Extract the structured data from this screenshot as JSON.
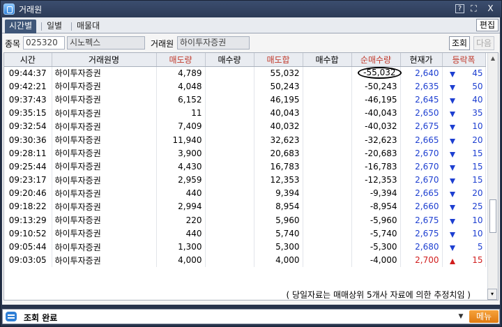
{
  "window": {
    "title": "거래원"
  },
  "titlebar_buttons": {
    "help": "?",
    "restore": "⛶",
    "close": "X"
  },
  "tabs": [
    {
      "label": "시간별",
      "active": true
    },
    {
      "label": "일별",
      "active": false
    },
    {
      "label": "매물대",
      "active": false
    }
  ],
  "edit_label": "편집",
  "filter": {
    "stock_label": "종목",
    "stock_code": "025320",
    "stock_name": "시노펙스",
    "broker_label": "거래원",
    "broker_name": "하이투자증권",
    "query_label": "조회",
    "next_label": "다음"
  },
  "columns": [
    "시간",
    "거래원명",
    "매도량",
    "매수량",
    "매도합",
    "매수합",
    "순매수량",
    "현재가",
    "등락폭"
  ],
  "rows": [
    {
      "time": "09:44:37",
      "broker": "하이투자증권",
      "sell": "4,789",
      "buy": "",
      "sell_sum": "55,032",
      "buy_sum": "",
      "net": "-55,032",
      "price": "2,640",
      "dir": "down",
      "chg": "45"
    },
    {
      "time": "09:42:21",
      "broker": "하이투자증권",
      "sell": "4,048",
      "buy": "",
      "sell_sum": "50,243",
      "buy_sum": "",
      "net": "-50,243",
      "price": "2,635",
      "dir": "down",
      "chg": "50"
    },
    {
      "time": "09:37:43",
      "broker": "하이투자증권",
      "sell": "6,152",
      "buy": "",
      "sell_sum": "46,195",
      "buy_sum": "",
      "net": "-46,195",
      "price": "2,645",
      "dir": "down",
      "chg": "40"
    },
    {
      "time": "09:35:15",
      "broker": "하이투자증권",
      "sell": "11",
      "buy": "",
      "sell_sum": "40,043",
      "buy_sum": "",
      "net": "-40,043",
      "price": "2,650",
      "dir": "down",
      "chg": "35"
    },
    {
      "time": "09:32:54",
      "broker": "하이투자증권",
      "sell": "7,409",
      "buy": "",
      "sell_sum": "40,032",
      "buy_sum": "",
      "net": "-40,032",
      "price": "2,675",
      "dir": "down",
      "chg": "10"
    },
    {
      "time": "09:30:36",
      "broker": "하이투자증권",
      "sell": "11,940",
      "buy": "",
      "sell_sum": "32,623",
      "buy_sum": "",
      "net": "-32,623",
      "price": "2,665",
      "dir": "down",
      "chg": "20"
    },
    {
      "time": "09:28:11",
      "broker": "하이투자증권",
      "sell": "3,900",
      "buy": "",
      "sell_sum": "20,683",
      "buy_sum": "",
      "net": "-20,683",
      "price": "2,670",
      "dir": "down",
      "chg": "15"
    },
    {
      "time": "09:25:44",
      "broker": "하이투자증권",
      "sell": "4,430",
      "buy": "",
      "sell_sum": "16,783",
      "buy_sum": "",
      "net": "-16,783",
      "price": "2,670",
      "dir": "down",
      "chg": "15"
    },
    {
      "time": "09:23:17",
      "broker": "하이투자증권",
      "sell": "2,959",
      "buy": "",
      "sell_sum": "12,353",
      "buy_sum": "",
      "net": "-12,353",
      "price": "2,670",
      "dir": "down",
      "chg": "15"
    },
    {
      "time": "09:20:46",
      "broker": "하이투자증권",
      "sell": "440",
      "buy": "",
      "sell_sum": "9,394",
      "buy_sum": "",
      "net": "-9,394",
      "price": "2,665",
      "dir": "down",
      "chg": "20"
    },
    {
      "time": "09:18:22",
      "broker": "하이투자증권",
      "sell": "2,994",
      "buy": "",
      "sell_sum": "8,954",
      "buy_sum": "",
      "net": "-8,954",
      "price": "2,660",
      "dir": "down",
      "chg": "25"
    },
    {
      "time": "09:13:29",
      "broker": "하이투자증권",
      "sell": "220",
      "buy": "",
      "sell_sum": "5,960",
      "buy_sum": "",
      "net": "-5,960",
      "price": "2,675",
      "dir": "down",
      "chg": "10"
    },
    {
      "time": "09:10:52",
      "broker": "하이투자증권",
      "sell": "440",
      "buy": "",
      "sell_sum": "5,740",
      "buy_sum": "",
      "net": "-5,740",
      "price": "2,675",
      "dir": "down",
      "chg": "10"
    },
    {
      "time": "09:05:44",
      "broker": "하이투자증권",
      "sell": "1,300",
      "buy": "",
      "sell_sum": "5,300",
      "buy_sum": "",
      "net": "-5,300",
      "price": "2,680",
      "dir": "down",
      "chg": "5"
    },
    {
      "time": "09:03:05",
      "broker": "하이투자증권",
      "sell": "4,000",
      "buy": "",
      "sell_sum": "4,000",
      "buy_sum": "",
      "net": "-4,000",
      "price": "2,700",
      "dir": "up",
      "chg": "15"
    }
  ],
  "note": "( 당일자료는 매매상위 5개사 자료에 의한 추정치임 )",
  "status": {
    "text": "조회 완료",
    "menu_label": "메뉴"
  },
  "colors": {
    "down": "#1d3fd1",
    "up": "#d11d1d",
    "sell_header": "#c0392b",
    "menu": "#e8891a"
  }
}
